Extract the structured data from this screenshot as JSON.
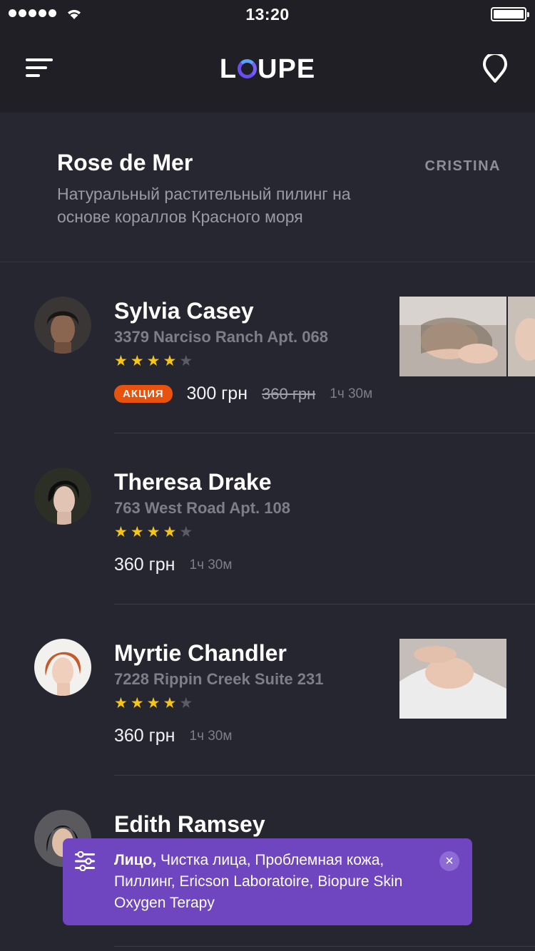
{
  "status_bar": {
    "time": "13:20"
  },
  "nav": {
    "logo": {
      "l": "L",
      "rest": "UPE"
    }
  },
  "header": {
    "title": "Rose de Mer",
    "brand": "CRISTINA",
    "description": "Натуральный растительный пилинг на основе кораллов Красного моря"
  },
  "items": [
    {
      "name": "Sylvia Casey",
      "address": "3379 Narciso Ranch Apt. 068",
      "rating": 4,
      "badge": "АКЦИЯ",
      "price": "300 грн",
      "old_price": "360 грн",
      "duration": "1ч 30м"
    },
    {
      "name": "Theresa Drake",
      "address": "763 West Road Apt. 108",
      "rating": 4,
      "price": "360 грн",
      "duration": "1ч 30м"
    },
    {
      "name": "Myrtie Chandler",
      "address": "7228 Rippin Creek Suite 231",
      "rating": 4,
      "price": "360 грн",
      "duration": "1ч 30м"
    },
    {
      "name": "Edith Ramsey"
    }
  ],
  "stars_glyph": {
    "on": "★★★★",
    "off": "★"
  },
  "filter_toast": {
    "category": "Лицо,",
    "tags": " Чистка лица, Проблемная кожа, Пиллинг, Ericson Laboratoire, Biopure Skin Oxygen Terapy",
    "close": "×"
  },
  "colors": {
    "accent": "#6f45c0",
    "badge": "#e8520f",
    "star": "#f5c518"
  }
}
